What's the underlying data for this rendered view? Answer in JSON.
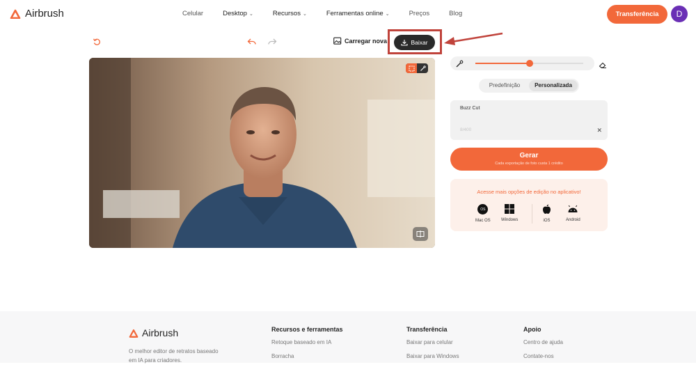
{
  "brand": {
    "name": "Airbrush",
    "accent": "#f2683a"
  },
  "nav": {
    "items": [
      {
        "label": "Celular",
        "dropdown": false
      },
      {
        "label": "Desktop",
        "dropdown": true
      },
      {
        "label": "Recursos",
        "dropdown": true
      },
      {
        "label": "Ferramentas online",
        "dropdown": true
      },
      {
        "label": "Preços",
        "dropdown": false
      },
      {
        "label": "Blog",
        "dropdown": false
      }
    ],
    "cta": "Transferência",
    "avatar_initial": "D"
  },
  "toolbar": {
    "reset_icon": "reset-icon",
    "undo_icon": "undo-icon",
    "redo_icon": "redo-icon",
    "upload_label": "Carregar nova",
    "download_label": "Baixar"
  },
  "editor": {
    "brush_slider_level": 0.5,
    "segments": [
      "Predefinição",
      "Personalizada"
    ],
    "active_segment": "Personalizada",
    "prompt_value": "Buzz Cut",
    "char_count": "8/400",
    "generate_label": "Gerar",
    "generate_sub": "Cada exportação de foto custa 1 crédito",
    "promo_title": "Acesse mais opções de edição no aplicativo!",
    "platforms": [
      {
        "label": "Mac OS",
        "icon": "macos-icon"
      },
      {
        "label": "Windows",
        "icon": "windows-icon"
      },
      {
        "label": "iOS",
        "icon": "apple-icon"
      },
      {
        "label": "Android",
        "icon": "android-icon"
      }
    ]
  },
  "footer": {
    "brand": "Airbrush",
    "description": "O melhor editor de retratos baseado em IA para criadores.",
    "columns": [
      {
        "title": "Recursos e ferramentas",
        "links": [
          "Retoque baseado em IA",
          "Borracha"
        ]
      },
      {
        "title": "Transferência",
        "links": [
          "Baixar para celular",
          "Baixar para Windows"
        ]
      },
      {
        "title": "Apoio",
        "links": [
          "Centro de ajuda",
          "Contate-nos"
        ]
      }
    ]
  }
}
